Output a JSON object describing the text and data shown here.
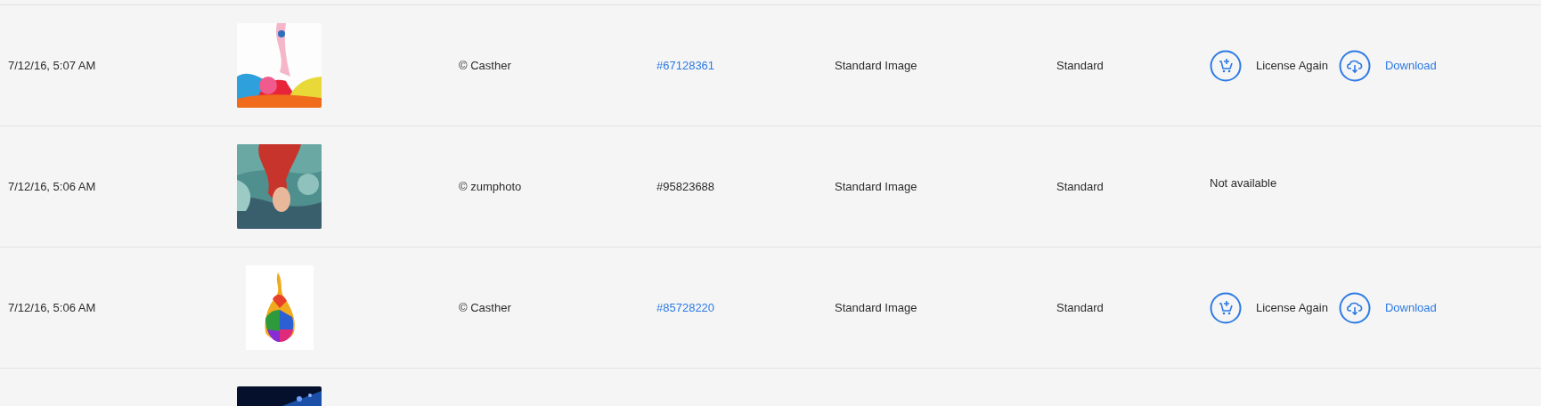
{
  "rows": [
    {
      "date": "7/12/16, 5:07 AM",
      "thumbnail": {
        "kind": "picture"
      },
      "credit": "© Casther",
      "asset_id": {
        "text": "#67128361",
        "link": true
      },
      "content_type": "Standard Image",
      "license": "Standard",
      "actions": [
        {
          "kind": "license",
          "label": "License Again"
        },
        {
          "kind": "download",
          "label": "Download"
        }
      ]
    },
    {
      "date": "7/12/16, 5:06 AM",
      "thumbnail": {
        "kind": "picture"
      },
      "credit": "© zumphoto",
      "asset_id": {
        "text": "#95823688",
        "link": false
      },
      "content_type": "Standard Image",
      "license": "Standard",
      "availability": "Not available"
    },
    {
      "date": "7/12/16, 5:06 AM",
      "thumbnail": {
        "kind": "picture"
      },
      "credit": "© Casther",
      "asset_id": {
        "text": "#85728220",
        "link": true
      },
      "content_type": "Standard Image",
      "license": "Standard",
      "actions": [
        {
          "kind": "license",
          "label": "License Again"
        },
        {
          "kind": "download",
          "label": "Download"
        }
      ]
    },
    {
      "thumbnail": {
        "kind": "picture"
      }
    }
  ]
}
